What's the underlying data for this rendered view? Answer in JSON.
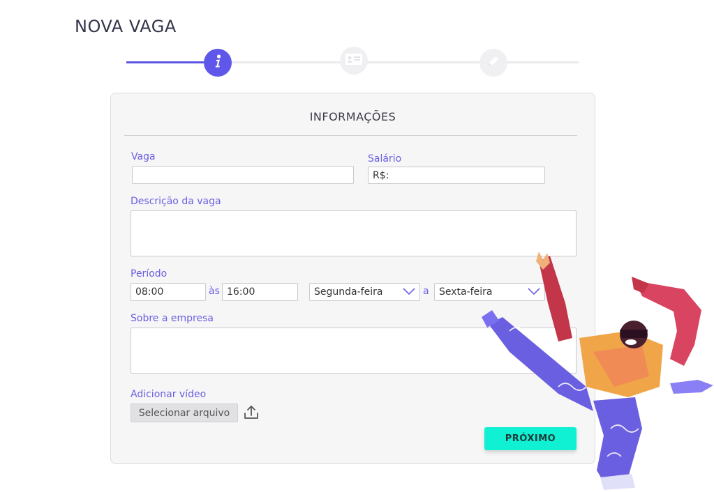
{
  "page": {
    "title": "NOVA VAGA"
  },
  "stepper": {
    "steps": [
      {
        "icon": "info-icon",
        "state": "active"
      },
      {
        "icon": "profile-card-icon",
        "state": "inactive"
      },
      {
        "icon": "pencil-icon",
        "state": "inactive"
      }
    ],
    "colors": {
      "active": "#5f57ea",
      "inactive": "#f0f0f2"
    }
  },
  "form": {
    "section_title": "INFORMAÇÕES",
    "vaga": {
      "label": "Vaga",
      "value": ""
    },
    "salario": {
      "label": "Salário",
      "value": "R$:"
    },
    "descricao": {
      "label": "Descrição da vaga",
      "value": ""
    },
    "periodo": {
      "label": "Período",
      "start_time": "08:00",
      "between_times": "às",
      "end_time": "16:00",
      "start_day": "Segunda-feira",
      "between_days": "a",
      "end_day": "Sexta-feira"
    },
    "sobre": {
      "label": "Sobre a empresa",
      "value": ""
    },
    "video": {
      "label": "Adicionar vídeo",
      "file_button": "Selecionar arquivo",
      "upload_icon": "upload-icon"
    },
    "next_button": "PRÓXIMO"
  },
  "colors": {
    "accent": "#5f57ea",
    "label": "#6a5fe0",
    "primary_button": "#10f0d2"
  }
}
